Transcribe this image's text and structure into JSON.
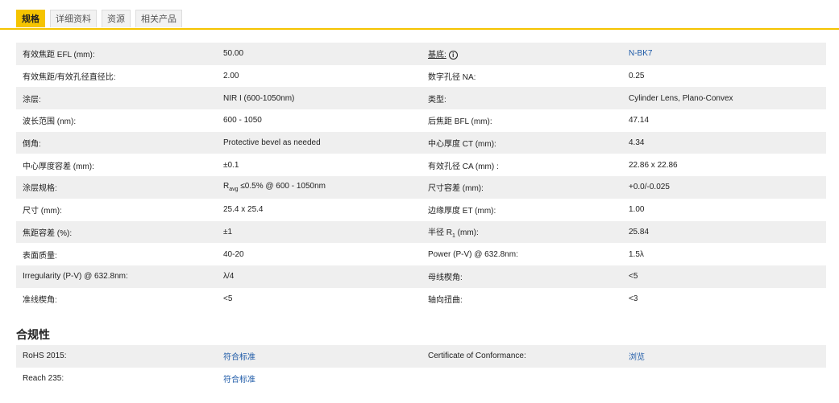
{
  "tabs": [
    {
      "label": "规格",
      "active": true
    },
    {
      "label": "详细资料",
      "active": false
    },
    {
      "label": "资源",
      "active": false
    },
    {
      "label": "相关产品",
      "active": false
    }
  ],
  "specs": [
    [
      "有效焦距 EFL (mm):",
      "50.00",
      "基底:",
      "N-BK7"
    ],
    [
      "有效焦距/有效孔径直径比:",
      "2.00",
      "数字孔径 NA:",
      "0.25"
    ],
    [
      "涂层:",
      "NIR I (600-1050nm)",
      "类型:",
      "Cylinder Lens, Plano-Convex"
    ],
    [
      "波长范围 (nm):",
      "600 - 1050",
      "后焦距 BFL (mm):",
      "47.14"
    ],
    [
      "倒角:",
      "Protective bevel as needed",
      "中心厚度 CT (mm):",
      "4.34"
    ],
    [
      "中心厚度容差 (mm):",
      "±0.1",
      "有效孔径 CA (mm) :",
      "22.86 x 22.86"
    ],
    [
      "涂层规格:",
      "",
      "尺寸容差 (mm):",
      "+0.0/-0.025"
    ],
    [
      "尺寸 (mm):",
      "25.4 x 25.4",
      "边缘厚度 ET (mm):",
      "1.00"
    ],
    [
      "焦距容差 (%):",
      "±1",
      "半径 R",
      "25.84"
    ],
    [
      "表面质量:",
      "40-20",
      "Power (P-V) @ 632.8nm:",
      "1.5λ"
    ],
    [
      "Irregularity (P-V) @ 632.8nm:",
      "λ/4",
      "母线楔角:",
      "<5"
    ],
    [
      "准线楔角:",
      "<5",
      "轴向扭曲:",
      "<3"
    ]
  ],
  "coating_spec": {
    "prefix": "R",
    "sub": "avg",
    "rest": " ≤0.5% @ 600 - 1050nm"
  },
  "radius_label": {
    "prefix": "半径 R",
    "sub": "1",
    "rest": " (mm):"
  },
  "substrate_info_icon": "i",
  "compliance": {
    "title": "合规性",
    "rows": [
      [
        "RoHS 2015:",
        "符合标准",
        "Certificate of Conformance:",
        "浏览"
      ],
      [
        "Reach 235:",
        "符合标准",
        "",
        ""
      ]
    ]
  }
}
